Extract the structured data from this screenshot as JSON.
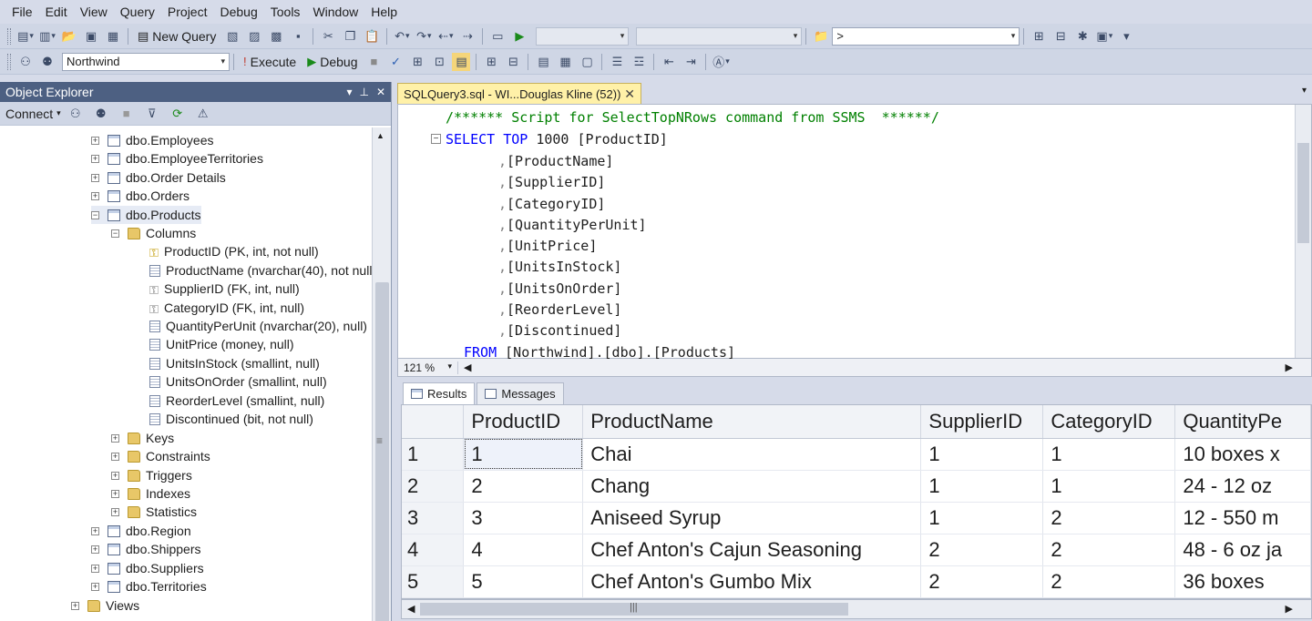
{
  "menu": [
    "File",
    "Edit",
    "View",
    "Query",
    "Project",
    "Debug",
    "Tools",
    "Window",
    "Help"
  ],
  "toolbar": {
    "new_query_label": "New Query",
    "search_value": ">",
    "database_value": "Northwind",
    "execute_label": "Execute",
    "debug_label": "Debug"
  },
  "object_explorer": {
    "title": "Object Explorer",
    "connect_label": "Connect",
    "nodes": [
      {
        "label": "dbo.Employees"
      },
      {
        "label": "dbo.EmployeeTerritories"
      },
      {
        "label": "dbo.Order Details"
      },
      {
        "label": "dbo.Orders"
      },
      {
        "label": "dbo.Products"
      },
      {
        "label": "Columns"
      },
      {
        "label": "ProductID (PK, int, not null)"
      },
      {
        "label": "ProductName (nvarchar(40), not null)"
      },
      {
        "label": "SupplierID (FK, int, null)"
      },
      {
        "label": "CategoryID (FK, int, null)"
      },
      {
        "label": "QuantityPerUnit (nvarchar(20), null)"
      },
      {
        "label": "UnitPrice (money, null)"
      },
      {
        "label": "UnitsInStock (smallint, null)"
      },
      {
        "label": "UnitsOnOrder (smallint, null)"
      },
      {
        "label": "ReorderLevel (smallint, null)"
      },
      {
        "label": "Discontinued (bit, not null)"
      },
      {
        "label": "Keys"
      },
      {
        "label": "Constraints"
      },
      {
        "label": "Triggers"
      },
      {
        "label": "Indexes"
      },
      {
        "label": "Statistics"
      },
      {
        "label": "dbo.Region"
      },
      {
        "label": "dbo.Shippers"
      },
      {
        "label": "dbo.Suppliers"
      },
      {
        "label": "dbo.Territories"
      },
      {
        "label": "Views"
      }
    ]
  },
  "document_tab": {
    "label": "SQLQuery3.sql - WI...Douglas Kline (52))"
  },
  "editor": {
    "comment": "/****** Script for SelectTopNRows command from SSMS  ******/",
    "select_kw": "SELECT TOP",
    "top_n": "1000",
    "first_col": "[ProductID]",
    "columns": [
      "[ProductName]",
      "[SupplierID]",
      "[CategoryID]",
      "[QuantityPerUnit]",
      "[UnitPrice]",
      "[UnitsInStock]",
      "[UnitsOnOrder]",
      "[ReorderLevel]",
      "[Discontinued]"
    ],
    "from_kw": "FROM",
    "from_target": "[Northwind].[dbo].[Products]",
    "zoom": "121 %"
  },
  "results": {
    "tabs": [
      "Results",
      "Messages"
    ],
    "headers": [
      "ProductID",
      "ProductName",
      "SupplierID",
      "CategoryID",
      "QuantityPe"
    ],
    "rows": [
      {
        "n": "1",
        "cells": [
          "1",
          "Chai",
          "1",
          "1",
          "10 boxes x"
        ]
      },
      {
        "n": "2",
        "cells": [
          "2",
          "Chang",
          "1",
          "1",
          "24 - 12 oz"
        ]
      },
      {
        "n": "3",
        "cells": [
          "3",
          "Aniseed Syrup",
          "1",
          "2",
          "12 - 550 m"
        ]
      },
      {
        "n": "4",
        "cells": [
          "4",
          "Chef Anton's Cajun Seasoning",
          "2",
          "2",
          "48 - 6 oz ja"
        ]
      },
      {
        "n": "5",
        "cells": [
          "5",
          "Chef Anton's Gumbo Mix",
          "2",
          "2",
          "36 boxes"
        ]
      }
    ]
  }
}
